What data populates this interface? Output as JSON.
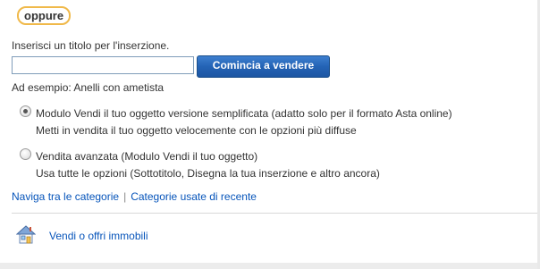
{
  "badge": {
    "text": "oppure"
  },
  "form": {
    "prompt": "Inserisci un titolo per l'inserzione.",
    "title_value": "",
    "start_button": "Comincia a vendere",
    "example": "Ad esempio: Anelli con ametista"
  },
  "options": [
    {
      "title": "Modulo Vendi il tuo oggetto versione semplificata (adatto solo per il formato Asta online)",
      "description": "Metti in vendita il tuo oggetto velocemente con le opzioni più diffuse",
      "selected": true
    },
    {
      "title": "Vendita avanzata (Modulo Vendi il tuo oggetto)",
      "description": "Usa tutte le opzioni (Sottotitolo, Disegna la tua inserzione e altro ancora)",
      "selected": false
    }
  ],
  "links": {
    "categories": "Naviga tra le categorie",
    "separator": "|",
    "recent": "Categorie usate di recente"
  },
  "property": {
    "label": "Vendi o offri immobili",
    "icon": "house-icon"
  },
  "colors": {
    "link": "#0654ba",
    "button": "#2463b5",
    "badge_border": "#f0b94a"
  }
}
